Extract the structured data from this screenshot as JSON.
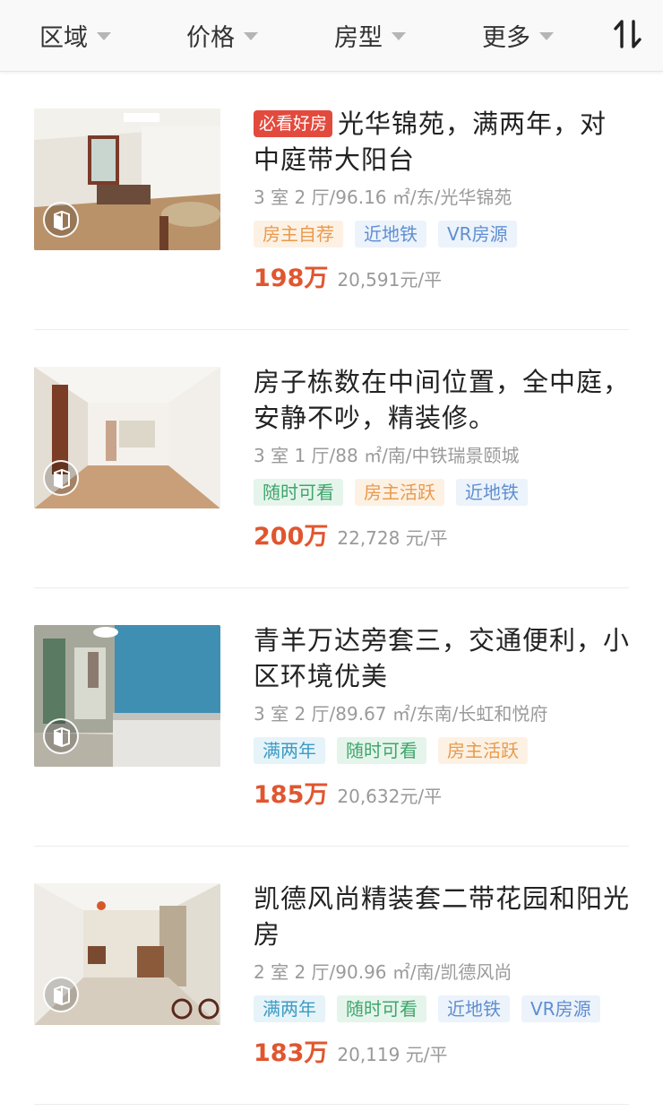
{
  "colors": {
    "accent_price": "#e0562f",
    "must_see_bg": "#e34a3e",
    "tag_orange_bg": "#fdf1e4",
    "tag_orange_fg": "#e99a4c",
    "tag_blue_bg": "#ecf3fb",
    "tag_blue_fg": "#5f8ed0",
    "tag_green_bg": "#e6f5ec",
    "tag_green_fg": "#3fa66c",
    "tag_cyan_bg": "#e6f4f9",
    "tag_cyan_fg": "#3e9bc4"
  },
  "filters": {
    "area": "区域",
    "price": "价格",
    "layout": "房型",
    "more": "更多",
    "sort_icon": "sort-icon"
  },
  "listings": [
    {
      "badge": "必看好房",
      "title": "光华锦苑，满两年，对中庭带大阳台",
      "meta": "3 室 2 厅/96.16 ㎡/东/光华锦苑",
      "tags": [
        {
          "label": "房主自荐",
          "style": "orange"
        },
        {
          "label": "近地铁",
          "style": "blue"
        },
        {
          "label": "VR房源",
          "style": "blue"
        }
      ],
      "price": "198万",
      "unit_price": "20,591元/平"
    },
    {
      "badge": "",
      "title": "房子栋数在中间位置，全中庭，安静不吵，精装修。",
      "meta": "3 室 1 厅/88 ㎡/南/中铁瑞景颐城",
      "tags": [
        {
          "label": "随时可看",
          "style": "green"
        },
        {
          "label": "房主活跃",
          "style": "orange"
        },
        {
          "label": "近地铁",
          "style": "blue"
        }
      ],
      "price": "200万",
      "unit_price": "22,728 元/平"
    },
    {
      "badge": "",
      "title": "青羊万达旁套三，交通便利，小区环境优美",
      "meta": "3 室 2 厅/89.67 ㎡/东南/长虹和悦府",
      "tags": [
        {
          "label": "满两年",
          "style": "cyan"
        },
        {
          "label": "随时可看",
          "style": "green"
        },
        {
          "label": "房主活跃",
          "style": "orange"
        }
      ],
      "price": "185万",
      "unit_price": "20,632元/平"
    },
    {
      "badge": "",
      "title": "凯德风尚精装套二带花园和阳光房",
      "meta": "2 室 2 厅/90.96 ㎡/南/凯德风尚",
      "tags": [
        {
          "label": "满两年",
          "style": "cyan"
        },
        {
          "label": "随时可看",
          "style": "green"
        },
        {
          "label": "近地铁",
          "style": "blue"
        },
        {
          "label": "VR房源",
          "style": "blue"
        }
      ],
      "price": "183万",
      "unit_price": "20,119 元/平"
    }
  ]
}
